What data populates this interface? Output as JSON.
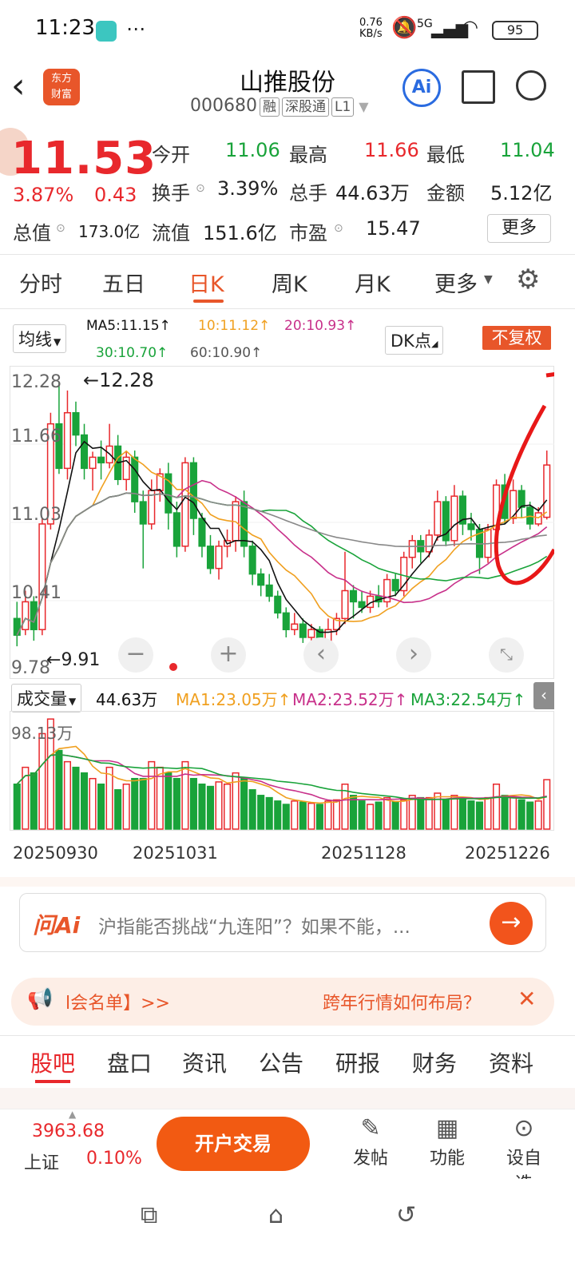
{
  "status": {
    "time": "11:23",
    "net_speed": "0.76\nKB/s",
    "network": "5G",
    "battery": "95"
  },
  "header": {
    "title": "山推股份",
    "code": "000680",
    "tags": [
      "融",
      "深股通",
      "L1"
    ],
    "logo": "东方\n财富",
    "ai": "Ai"
  },
  "quote": {
    "price": "11.53",
    "change_pct": "3.87%",
    "change": "0.43",
    "open_label": "今开",
    "open": "11.06",
    "high_label": "最高",
    "high": "11.66",
    "low_label": "最低",
    "low": "11.04",
    "turnover_label": "换手",
    "turnover": "3.39%",
    "volume_label": "总手",
    "volume": "44.63万",
    "amount_label": "金额",
    "amount": "5.12亿",
    "mktcap_label": "总值",
    "mktcap": "173.0亿",
    "float_label": "流值",
    "float": "151.6亿",
    "pe_label": "市盈",
    "pe": "15.47",
    "more": "更多"
  },
  "period_tabs": [
    "分时",
    "五日",
    "日K",
    "周K",
    "月K",
    "更多"
  ],
  "active_period": "日K",
  "ma": {
    "selector": "均线",
    "ma5": "MA5:11.15↑",
    "ma10": "10:11.12↑",
    "ma20": "20:10.93↑",
    "ma30": "30:10.70↑",
    "ma60": "60:10.90↑",
    "dk": "DK点",
    "fq": "不复权"
  },
  "colors": {
    "up": "#e8282c",
    "down": "#19a33a",
    "accent": "#e8562a",
    "ma5": "#111111",
    "ma10": "#f0a020",
    "ma20": "#c8308a",
    "ma30": "#19a33a",
    "ma60": "#888888"
  },
  "chart_data": {
    "type": "candlestick",
    "y_ticks": [
      "12.28",
      "11.66",
      "11.03",
      "10.41",
      "9.78"
    ],
    "high_label": "12.28",
    "low_label": "9.91",
    "ohlc": [
      [
        10.15,
        10.0,
        10.3,
        9.9
      ],
      [
        10.05,
        10.3,
        10.4,
        10.0
      ],
      [
        10.3,
        10.05,
        10.35,
        9.95
      ],
      [
        10.05,
        11.0,
        11.05,
        10.0
      ],
      [
        11.0,
        11.9,
        12.0,
        10.95
      ],
      [
        11.9,
        11.5,
        12.28,
        11.45
      ],
      [
        11.5,
        12.0,
        12.2,
        11.4
      ],
      [
        12.0,
        11.8,
        12.1,
        11.7
      ],
      [
        11.8,
        11.5,
        11.9,
        11.4
      ],
      [
        11.5,
        11.6,
        11.65,
        11.3
      ],
      [
        11.6,
        11.55,
        11.75,
        11.4
      ],
      [
        11.55,
        11.7,
        11.9,
        11.5
      ],
      [
        11.7,
        11.4,
        11.8,
        11.35
      ],
      [
        11.4,
        11.6,
        11.65,
        11.3
      ],
      [
        11.6,
        11.2,
        11.66,
        11.1
      ],
      [
        11.2,
        11.0,
        11.3,
        10.6
      ],
      [
        11.0,
        11.3,
        11.4,
        10.95
      ],
      [
        11.3,
        11.45,
        11.5,
        11.2
      ],
      [
        11.45,
        11.1,
        11.55,
        10.95
      ],
      [
        11.1,
        10.8,
        11.2,
        10.7
      ],
      [
        10.8,
        11.55,
        11.6,
        10.75
      ],
      [
        11.55,
        11.05,
        11.6,
        10.9
      ],
      [
        11.05,
        10.8,
        11.1,
        10.7
      ],
      [
        10.8,
        10.6,
        10.9,
        10.55
      ],
      [
        10.6,
        10.8,
        10.85,
        10.5
      ],
      [
        10.8,
        10.85,
        10.95,
        10.7
      ],
      [
        10.85,
        11.2,
        11.25,
        10.75
      ],
      [
        11.2,
        10.8,
        11.3,
        10.7
      ],
      [
        10.8,
        10.55,
        10.85,
        10.45
      ],
      [
        10.55,
        10.45,
        10.6,
        10.35
      ],
      [
        10.45,
        10.35,
        10.55,
        10.3
      ],
      [
        10.35,
        10.2,
        10.4,
        10.15
      ],
      [
        10.2,
        10.05,
        10.25,
        9.98
      ],
      [
        10.05,
        10.1,
        10.2,
        10.0
      ],
      [
        10.1,
        9.98,
        10.15,
        9.93
      ],
      [
        9.98,
        10.05,
        10.1,
        9.95
      ],
      [
        10.05,
        9.95,
        10.08,
        9.91
      ],
      [
        9.95,
        10.05,
        10.15,
        9.92
      ],
      [
        10.05,
        10.15,
        10.2,
        10.0
      ],
      [
        10.15,
        10.4,
        10.75,
        10.1
      ],
      [
        10.4,
        10.3,
        10.45,
        10.15
      ],
      [
        10.3,
        10.25,
        10.4,
        10.2
      ],
      [
        10.25,
        10.35,
        10.4,
        10.2
      ],
      [
        10.35,
        10.3,
        10.45,
        10.25
      ],
      [
        10.3,
        10.5,
        10.55,
        10.25
      ],
      [
        10.5,
        10.4,
        10.55,
        10.35
      ],
      [
        10.4,
        10.7,
        10.75,
        10.35
      ],
      [
        10.7,
        10.85,
        10.9,
        10.6
      ],
      [
        10.85,
        10.75,
        10.9,
        10.65
      ],
      [
        10.75,
        10.9,
        10.95,
        10.7
      ],
      [
        10.9,
        11.2,
        11.3,
        10.85
      ],
      [
        11.2,
        10.85,
        11.25,
        10.8
      ],
      [
        10.85,
        11.25,
        11.35,
        10.8
      ],
      [
        11.25,
        11.0,
        11.3,
        10.9
      ],
      [
        11.0,
        10.95,
        11.1,
        10.85
      ],
      [
        10.95,
        10.7,
        11.0,
        10.55
      ],
      [
        10.7,
        10.95,
        11.0,
        10.65
      ],
      [
        10.95,
        11.35,
        11.4,
        10.9
      ],
      [
        11.35,
        11.05,
        11.45,
        11.0
      ],
      [
        11.05,
        11.3,
        11.4,
        11.0
      ],
      [
        11.3,
        11.15,
        11.35,
        11.05
      ],
      [
        11.15,
        11.0,
        11.2,
        10.95
      ],
      [
        11.0,
        11.1,
        11.15,
        10.98
      ],
      [
        11.06,
        11.53,
        11.66,
        11.04
      ]
    ],
    "volume_label": "成交量",
    "volume": "44.63万",
    "vol_ma1": "MA1:23.05万↑",
    "vol_ma2": "MA2:23.52万↑",
    "vol_ma3": "MA3:22.54万↑",
    "vol_max": "98.13万",
    "dates": [
      "20250930",
      "20251031",
      "20251128",
      "20251226"
    ],
    "volumes": [
      40,
      55,
      50,
      85,
      98,
      70,
      60,
      55,
      50,
      45,
      40,
      55,
      35,
      40,
      45,
      45,
      60,
      55,
      50,
      45,
      60,
      45,
      40,
      38,
      42,
      40,
      50,
      45,
      35,
      30,
      28,
      25,
      22,
      25,
      24,
      23,
      22,
      25,
      26,
      40,
      30,
      25,
      22,
      24,
      28,
      24,
      26,
      30,
      28,
      28,
      32,
      26,
      30,
      27,
      25,
      24,
      28,
      40,
      30,
      28,
      26,
      24,
      25,
      44
    ]
  },
  "ai_bar": {
    "label": "问Ai",
    "question": "沪指能否挑战“九连阳”？如果不能，..."
  },
  "notice": {
    "left": "l会名单】>>",
    "right": "跨年行情如何布局？"
  },
  "bottom_tabs": [
    "股吧",
    "盘口",
    "资讯",
    "公告",
    "研报",
    "财务",
    "资料"
  ],
  "bottom_bar": {
    "index_value": "3963.68",
    "index_name": "上证",
    "index_change": "0.10%",
    "open_trade": "开户交易",
    "post": "发帖",
    "func": "功能",
    "fav": "设自选"
  }
}
